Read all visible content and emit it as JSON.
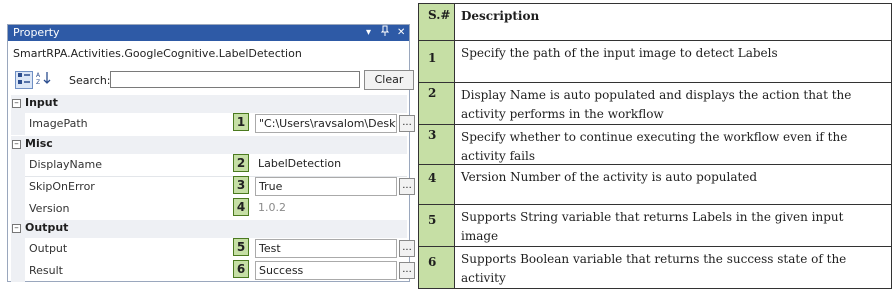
{
  "panel": {
    "title": "Property",
    "title_controls": [
      "▾",
      "ᵖ",
      "✕"
    ],
    "object_name": "SmartRPA.Activities.GoogleCognitive.LabelDetection",
    "toolbar": {
      "search_label": "Search:",
      "search_value": "",
      "clear_label": "Clear"
    },
    "categories": {
      "input": "Input",
      "misc": "Misc",
      "output": "Output"
    },
    "properties": {
      "image_path": {
        "name": "ImagePath",
        "badge": "1",
        "value": "\"C:\\Users\\ravsalom\\Deskt"
      },
      "display_name": {
        "name": "DisplayName",
        "badge": "2",
        "value": "LabelDetection"
      },
      "skip_on_error": {
        "name": "SkipOnError",
        "badge": "3",
        "value": "True"
      },
      "version": {
        "name": "Version",
        "badge": "4",
        "value": "1.0.2"
      },
      "output": {
        "name": "Output",
        "badge": "5",
        "value": "Test"
      },
      "result": {
        "name": "Result",
        "badge": "6",
        "value": "Success"
      }
    },
    "ellipsis": "..."
  },
  "table": {
    "header": {
      "num": "S.#",
      "desc": "Description"
    },
    "rows": [
      {
        "num": "1",
        "desc": "Specify the path of the input image to detect Labels"
      },
      {
        "num": "2",
        "desc": "Display Name is auto populated and displays the action that the activity performs in the workflow"
      },
      {
        "num": "3",
        "desc": "Specify whether to continue executing the workflow even if the activity fails"
      },
      {
        "num": "4",
        "desc": "Version Number of the activity is auto populated"
      },
      {
        "num": "5",
        "desc": "Supports String variable that returns Labels in the given input image"
      },
      {
        "num": "6",
        "desc": "Supports Boolean variable that returns the success state of the activity"
      }
    ]
  },
  "colors": {
    "titlebar": "#2e5aa6",
    "badge": "#c6dfa5",
    "table_num_column": "#c6dfa5"
  }
}
